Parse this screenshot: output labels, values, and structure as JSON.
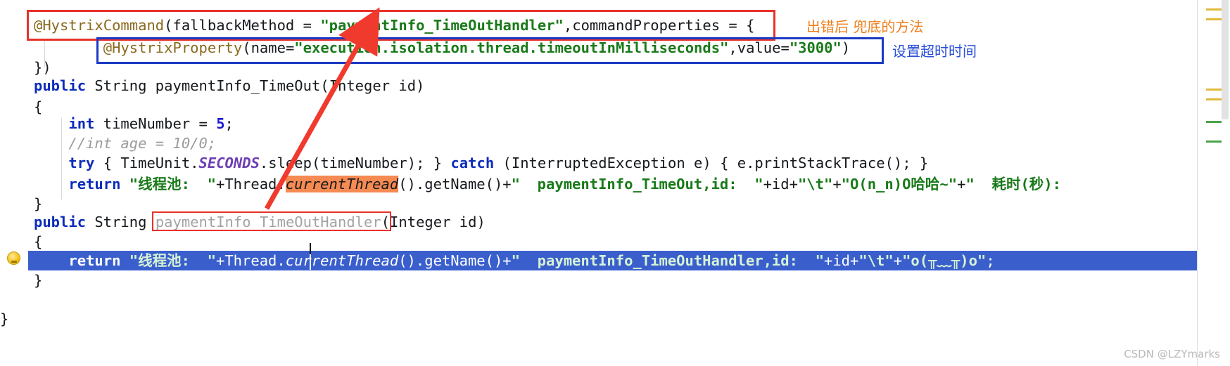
{
  "editor": {
    "language": "java",
    "watermark": "CSDN @LZYmarks",
    "caret_symbol": "I"
  },
  "annotations": [
    {
      "id": "note-fallback",
      "text": "出错后 兜底的方法",
      "color": "#f07d1a"
    },
    {
      "id": "note-timeout",
      "text": "设置超时时间",
      "color": "#2b4fd8"
    }
  ],
  "boxes": {
    "red_top_label": "red-box-hystrix-command",
    "blue_label": "blue-box-hystrix-property",
    "red_method_label": "red-box-fallback-method-name"
  },
  "code_lines": [
    {
      "id": "line-hystrix-command",
      "text": "@HystrixCommand(fallbackMethod = \"paymentInfo_TimeOutHandler\",commandProperties = {",
      "parts": [
        {
          "t": "@HystrixCommand",
          "c": "annot"
        },
        {
          "t": "(fallbackMethod = ",
          "c": "plain"
        },
        {
          "t": "\"paymentInfo_TimeOutHandler\"",
          "c": "str"
        },
        {
          "t": ",commandProperties = {",
          "c": "plain"
        }
      ]
    },
    {
      "id": "line-hystrix-property",
      "text": "        @HystrixProperty(name=\"execution.isolation.thread.timeoutInMilliseconds\",value=\"3000\")",
      "parts": [
        {
          "t": "        ",
          "c": "plain"
        },
        {
          "t": "@HystrixProperty",
          "c": "annot"
        },
        {
          "t": "(name=",
          "c": "plain"
        },
        {
          "t": "\"execution.isolation.thread.timeoutInMilliseconds\"",
          "c": "str"
        },
        {
          "t": ",value=",
          "c": "plain"
        },
        {
          "t": "\"3000\"",
          "c": "str"
        },
        {
          "t": ")",
          "c": "plain"
        }
      ]
    },
    {
      "id": "line-close-annotation",
      "text": "})",
      "parts": [
        {
          "t": "})",
          "c": "plain"
        }
      ]
    },
    {
      "id": "line-method-signature",
      "text": "public String paymentInfo_TimeOut(Integer id)",
      "parts": [
        {
          "t": "public",
          "c": "kw"
        },
        {
          "t": " String paymentInfo_TimeOut(Integer id)",
          "c": "plain"
        }
      ]
    },
    {
      "id": "line-open-brace-1",
      "text": "{",
      "parts": [
        {
          "t": "{",
          "c": "plain"
        }
      ]
    },
    {
      "id": "line-int-timenumber",
      "text": "    int timeNumber = 5;",
      "parts": [
        {
          "t": "    ",
          "c": "plain"
        },
        {
          "t": "int",
          "c": "kw"
        },
        {
          "t": " timeNumber = ",
          "c": "plain"
        },
        {
          "t": "5",
          "c": "num"
        },
        {
          "t": ";",
          "c": "plain"
        }
      ]
    },
    {
      "id": "line-comment-age",
      "text": "    //int age = 10/0;",
      "parts": [
        {
          "t": "    ",
          "c": "plain"
        },
        {
          "t": "//int age = 10/0;",
          "c": "cmt"
        }
      ]
    },
    {
      "id": "line-try-catch",
      "text": "    try { TimeUnit.SECONDS.sleep(timeNumber); } catch (InterruptedException e) { e.printStackTrace(); }",
      "parts": [
        {
          "t": "    ",
          "c": "plain"
        },
        {
          "t": "try",
          "c": "kw"
        },
        {
          "t": " { TimeUnit.",
          "c": "plain"
        },
        {
          "t": "SECONDS",
          "c": "stat"
        },
        {
          "t": ".sleep(timeNumber); } ",
          "c": "plain"
        },
        {
          "t": "catch",
          "c": "kw"
        },
        {
          "t": " (InterruptedException e) { e.printStackTrace(); }",
          "c": "plain"
        }
      ]
    },
    {
      "id": "line-return-timeout",
      "text": "    return \"线程池:  \"+Thread.currentThread().getName()+\"  paymentInfo_TimeOut,id:  \"+id+\"\\t\"+\"O(n_n)O哈哈~\"+\"  耗时(秒):",
      "parts": [
        {
          "t": "    ",
          "c": "plain"
        },
        {
          "t": "return",
          "c": "kw"
        },
        {
          "t": " ",
          "c": "plain"
        },
        {
          "t": "\"线程池:  \"",
          "c": "str"
        },
        {
          "t": "+Thread.",
          "c": "plain"
        },
        {
          "t": "currentThread",
          "c": "hl-orange"
        },
        {
          "t": "().getName()+",
          "c": "plain"
        },
        {
          "t": "\"  paymentInfo_TimeOut,id:  \"",
          "c": "str"
        },
        {
          "t": "+id+",
          "c": "plain"
        },
        {
          "t": "\"\\t\"",
          "c": "str"
        },
        {
          "t": "+",
          "c": "plain"
        },
        {
          "t": "\"O(n_n)O哈哈~\"",
          "c": "str"
        },
        {
          "t": "+",
          "c": "plain"
        },
        {
          "t": "\"  耗时(秒):",
          "c": "str"
        }
      ]
    },
    {
      "id": "line-close-brace-1",
      "text": "}",
      "parts": [
        {
          "t": "}",
          "c": "plain"
        }
      ]
    },
    {
      "id": "line-handler-signature",
      "text": "public String paymentInfo_TimeOutHandler(Integer id)",
      "parts": [
        {
          "t": "public",
          "c": "kw"
        },
        {
          "t": " String ",
          "c": "plain"
        },
        {
          "t": "paymentInfo_TimeOutHandler",
          "c": "unused"
        },
        {
          "t": "(Integer id)",
          "c": "plain"
        }
      ]
    },
    {
      "id": "line-open-brace-2",
      "text": "{",
      "parts": [
        {
          "t": "{",
          "c": "plain"
        }
      ]
    },
    {
      "id": "line-return-handler",
      "text": "    return \"线程池:  \"+Thread.currentThread().getName()+\"  paymentInfo_TimeOutHandler,id:  \"+id+\"\\t\"+\"o(╥﹏╥)o\";",
      "selected": true,
      "parts": [
        {
          "t": "    ",
          "c": "plain"
        },
        {
          "t": "return",
          "c": "kw"
        },
        {
          "t": " ",
          "c": "plain"
        },
        {
          "t": "\"线程池:  \"",
          "c": "str"
        },
        {
          "t": "+Thread.",
          "c": "plain"
        },
        {
          "t": "currentThread",
          "c": "italicfield"
        },
        {
          "t": "().getName()+",
          "c": "plain"
        },
        {
          "t": "\"  paymentInfo_TimeOutHandler,id:  \"",
          "c": "str"
        },
        {
          "t": "+id+",
          "c": "plain"
        },
        {
          "t": "\"\\t\"",
          "c": "str"
        },
        {
          "t": "+",
          "c": "plain"
        },
        {
          "t": "\"o(╥﹏╥)o\"",
          "c": "str"
        },
        {
          "t": ";",
          "c": "plain"
        }
      ]
    },
    {
      "id": "line-close-brace-2",
      "text": "}",
      "parts": [
        {
          "t": "}",
          "c": "plain"
        }
      ]
    },
    {
      "id": "line-close-class",
      "text": "}",
      "parts": [
        {
          "t": "}",
          "c": "plain"
        }
      ]
    }
  ]
}
